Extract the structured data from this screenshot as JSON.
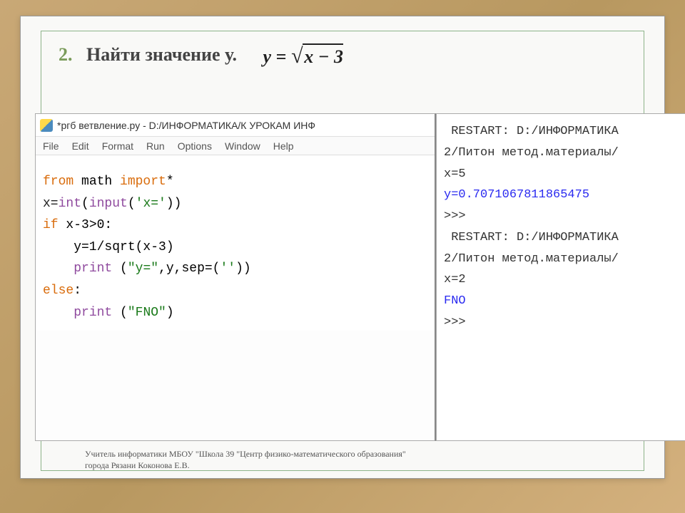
{
  "title": {
    "number": "2.",
    "text": "Найти значение у.",
    "formula_lhs": "y = ",
    "formula_radicand": "x − 3"
  },
  "editor": {
    "window_title": "*ргб ветвление.ру - D:/ИНФОРМАТИКА/К УРОКАМ ИНФ",
    "menu": [
      "File",
      "Edit",
      "Format",
      "Run",
      "Options",
      "Window",
      "Help"
    ],
    "code": {
      "l1_from": "from",
      "l1_math": " math ",
      "l1_import": "import",
      "l1_star": "*",
      "l2_a": "x=",
      "l2_int": "int",
      "l2_b": "(",
      "l2_input": "input",
      "l2_c": "(",
      "l2_str": "'x='",
      "l2_d": "))",
      "l3_if": "if",
      "l3_cond": " x-3>0:",
      "l4": "    y=1/sqrt(x-3)",
      "l5_a": "    ",
      "l5_print": "print",
      "l5_b": " (",
      "l5_s1": "\"y=\"",
      "l5_c": ",y,sep=(",
      "l5_s2": "''",
      "l5_d": "))",
      "l6_else": "else",
      "l6_colon": ":",
      "l7_a": "    ",
      "l7_print": "print",
      "l7_b": " (",
      "l7_s": "\"FNO\"",
      "l7_c": ")"
    }
  },
  "shell": {
    "r1": " RESTART: D:/ИНФОРМАТИКА",
    "r2": "2/Питон метод.материалы/",
    "x1": "x=5",
    "y1": "y=0.7071067811865475",
    "p1": ">>> ",
    "r3": " RESTART: D:/ИНФОРМАТИКА",
    "r4": "2/Питон метод.материалы/",
    "x2": "x=2",
    "fno": "FNO",
    "p2": ">>> "
  },
  "footer": {
    "line1": "Учитель информатики МБОУ \"Школа 39 \"Центр физико-математического образования\"",
    "line2": "города Рязани Коконова Е.В."
  }
}
